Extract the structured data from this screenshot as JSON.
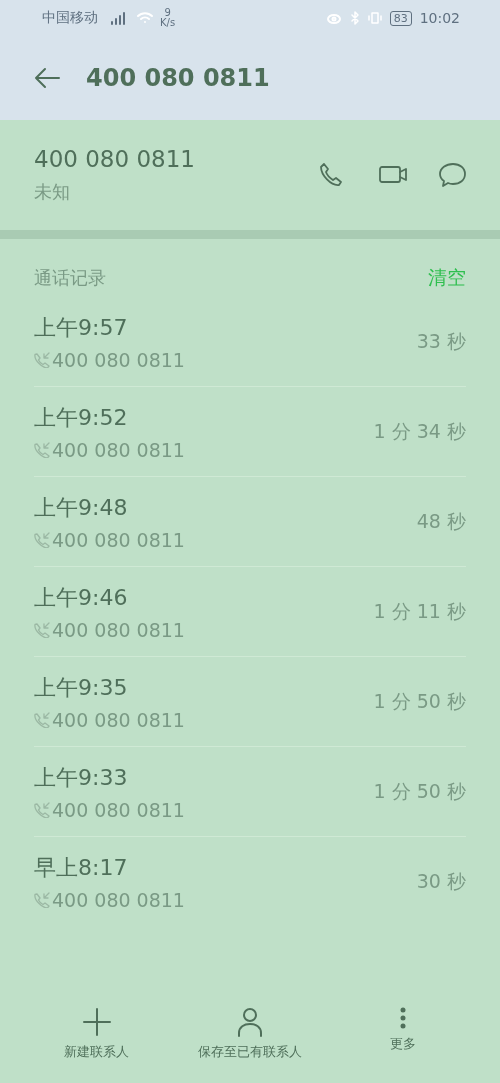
{
  "status_bar": {
    "carrier": "中国移动",
    "speed_value": "9",
    "speed_unit": "K/s",
    "battery": "83",
    "time": "10:02"
  },
  "header": {
    "title": "400 080 0811"
  },
  "contact": {
    "number": "400 080 0811",
    "label": "未知"
  },
  "call_log": {
    "title": "通话记录",
    "clear_label": "清空",
    "calls": [
      {
        "time": "上午9:57",
        "number": "400 080 0811",
        "duration": "33 秒"
      },
      {
        "time": "上午9:52",
        "number": "400 080 0811",
        "duration": "1 分 34 秒"
      },
      {
        "time": "上午9:48",
        "number": "400 080 0811",
        "duration": "48 秒"
      },
      {
        "time": "上午9:46",
        "number": "400 080 0811",
        "duration": "1 分 11 秒"
      },
      {
        "time": "上午9:35",
        "number": "400 080 0811",
        "duration": "1 分 50 秒"
      },
      {
        "time": "上午9:33",
        "number": "400 080 0811",
        "duration": "1 分 50 秒"
      },
      {
        "time": "早上8:17",
        "number": "400 080 0811",
        "duration": "30 秒"
      }
    ]
  },
  "bottom_bar": [
    {
      "kind": "add",
      "label": "新建联系人"
    },
    {
      "kind": "person",
      "label": "保存至已有联系人"
    },
    {
      "kind": "more",
      "label": "更多"
    }
  ]
}
